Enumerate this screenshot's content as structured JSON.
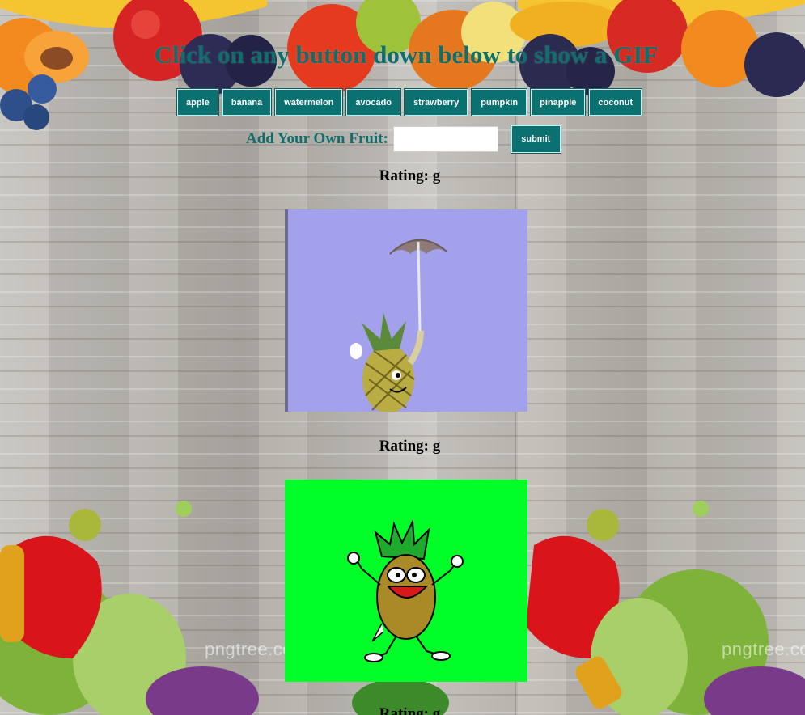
{
  "header": {
    "title": "Click on any button down below to show a GIF"
  },
  "fruit_buttons": [
    {
      "label": "apple"
    },
    {
      "label": "banana"
    },
    {
      "label": "watermelon"
    },
    {
      "label": "avocado"
    },
    {
      "label": "strawberry"
    },
    {
      "label": "pumpkin"
    },
    {
      "label": "pinapple"
    },
    {
      "label": "coconut"
    }
  ],
  "add_fruit": {
    "label": "Add Your Own Fruit:",
    "input_value": "",
    "submit_label": "submit"
  },
  "gifs": [
    {
      "rating_label": "Rating: g",
      "icon": "umbrella-pineapple-gif"
    },
    {
      "rating_label": "Rating: g",
      "icon": "dancing-pineapple-gif"
    },
    {
      "rating_label": "Rating: g"
    }
  ],
  "watermarks": [
    "pngtree.com",
    "pngtree.co"
  ],
  "colors": {
    "accent": "#0b7070",
    "title": "#0f6f6c",
    "gif1_bg": "#a4a1ec",
    "gif2_bg": "#00ff29"
  }
}
